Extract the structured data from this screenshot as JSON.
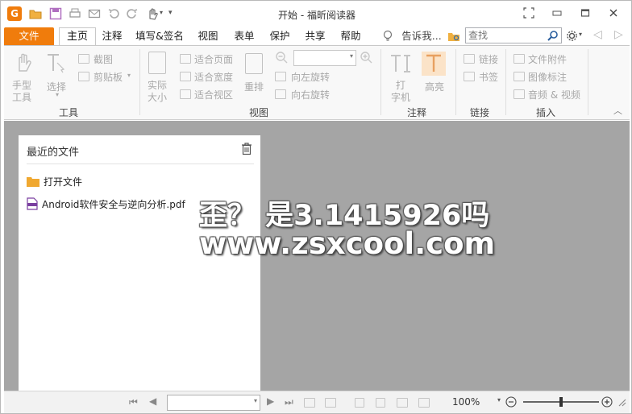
{
  "window": {
    "title": "开始 - 福昕阅读器"
  },
  "quick_access": {
    "icons": [
      "app-logo-icon",
      "open-folder-icon",
      "save-icon",
      "print-icon",
      "email-icon",
      "undo-icon",
      "redo-icon",
      "hand-tool-icon",
      "customize-dropdown-icon"
    ]
  },
  "tabs": {
    "file": "文件",
    "home": "主页",
    "comment": "注释",
    "fill_sign": "填写&签名",
    "view": "视图",
    "form": "表单",
    "protect": "保护",
    "share": "共享",
    "help": "帮助",
    "tell_me": "告诉我...",
    "search_placeholder": "查找"
  },
  "ribbon": {
    "tools": {
      "hand_label": "手型\n工具",
      "select_label": "选择",
      "snapshot_label": "截图",
      "clipboard_label": "剪贴板",
      "group_label": "工具"
    },
    "view": {
      "actual_size_label": "实际\n大小",
      "fit_page": "适合页面",
      "fit_width": "适合宽度",
      "fit_visible": "适合视区",
      "reflow_label": "重排",
      "rotate_left": "向左旋转",
      "rotate_right": "向右旋转",
      "zoom_value": "",
      "group_label": "视图"
    },
    "comment": {
      "typewriter_label": "打\n字机",
      "highlight_label": "高亮",
      "group_label": "注释"
    },
    "links": {
      "link_label": "链接",
      "bookmark_label": "书签",
      "group_label": "链接"
    },
    "insert": {
      "attachment_label": "文件附件",
      "image_label": "图像标注",
      "av_label": "音频 & 视频",
      "group_label": "插入"
    }
  },
  "recent_panel": {
    "title": "最近的文件",
    "open_file": "打开文件",
    "files": [
      "Android软件安全与逆向分析.pdf"
    ]
  },
  "watermark": {
    "line1": "歪？ 是3.1415926吗",
    "line2": "www.zsxcool.com"
  },
  "status": {
    "page_value": "",
    "zoom": "100%",
    "zoom_level": 0.5
  },
  "colors": {
    "accent": "#f07c0c",
    "workspace": "#a5a5a5",
    "folder": "#f0a830",
    "pdf_icon": "#7a3fa0",
    "highlight_bg": "#fbe3c8"
  }
}
